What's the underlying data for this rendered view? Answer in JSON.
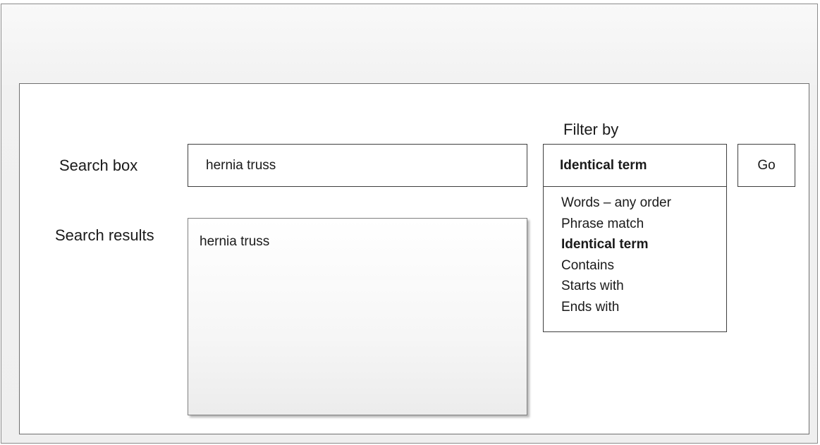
{
  "labels": {
    "filter_by": "Filter by",
    "search_box": "Search box",
    "search_results": "Search results"
  },
  "search": {
    "value": "hernia truss"
  },
  "results": {
    "items": [
      "hernia truss"
    ]
  },
  "filter": {
    "selected": "Identical term",
    "options": [
      "Words – any order",
      "Phrase match",
      "Identical term",
      "Contains",
      "Starts with",
      "Ends with"
    ],
    "selected_index": 2
  },
  "go_button": {
    "label": "Go"
  }
}
